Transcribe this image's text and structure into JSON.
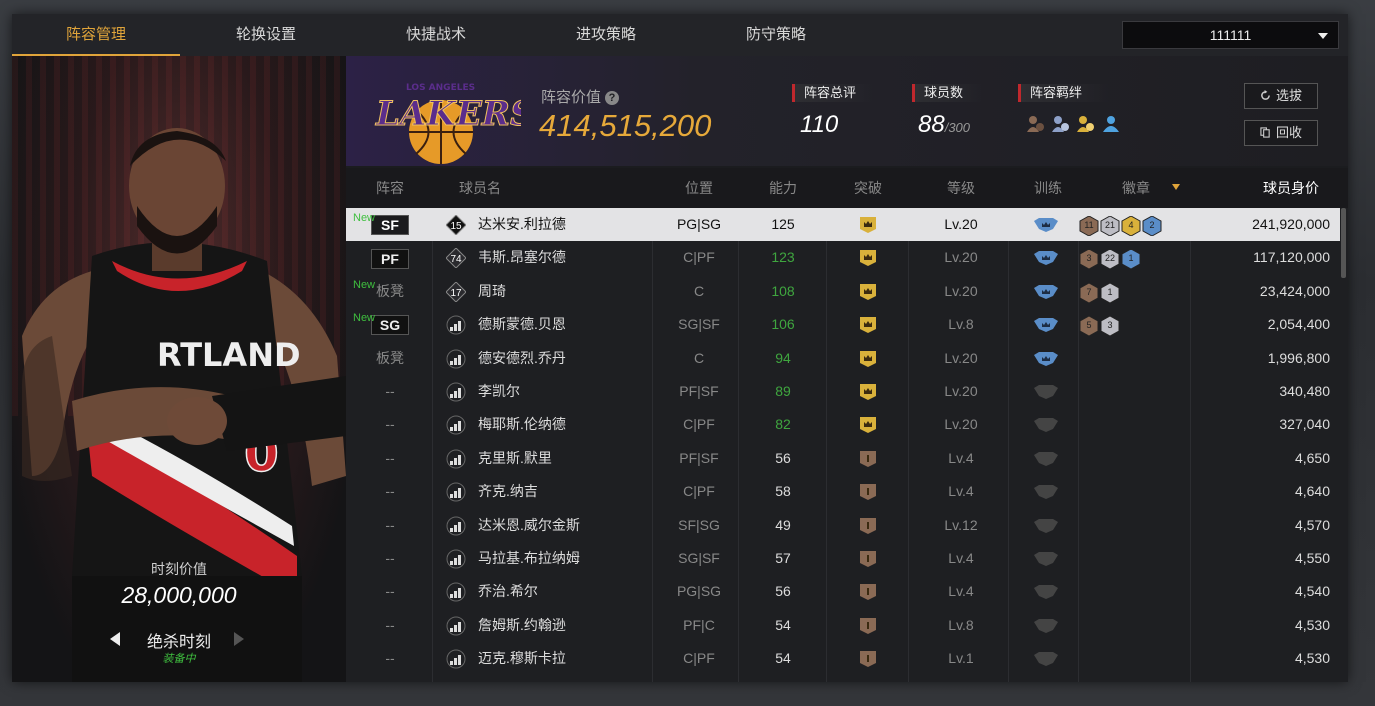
{
  "tabs": [
    {
      "label": "阵容管理",
      "active": true
    },
    {
      "label": "轮换设置",
      "active": false
    },
    {
      "label": "快捷战术",
      "active": false
    },
    {
      "label": "进攻策略",
      "active": false
    },
    {
      "label": "防守策略",
      "active": false
    }
  ],
  "team_select": {
    "value": "111111"
  },
  "left_panel": {
    "moment_label": "时刻价值",
    "moment_value": "28,000,000",
    "moment_name": "绝杀时刻",
    "moment_status": "装备中",
    "jersey_text": "RTLAND",
    "jersey_number": "0"
  },
  "header": {
    "logo_text": "LAKERS",
    "logo_subtext": "LOS ANGELES",
    "value_label": "阵容价值",
    "value": "414,515,200",
    "rating_label": "阵容总评",
    "rating_value": "110",
    "count_label": "球员数",
    "count_value": "88",
    "count_max": "/300",
    "bond_label": "阵容羁绊",
    "draft_button": "选拔",
    "recycle_button": "回收"
  },
  "columns": {
    "lineup": "阵容",
    "name": "球员名",
    "position": "位置",
    "ability": "能力",
    "breakthrough": "突破",
    "level": "等级",
    "training": "训练",
    "badges": "徽章",
    "price": "球员身价"
  },
  "players": [
    {
      "lineup": "SF",
      "lineup_type": "badge",
      "new": "New",
      "number": "15",
      "name": "达米安.利拉德",
      "position": "PG|SG",
      "ability": "125",
      "ability_color": "white",
      "crown": "gold",
      "level": "Lv.20",
      "training": "blue",
      "badges": [
        {
          "v": "11",
          "c": "bronze"
        },
        {
          "v": "21",
          "c": "silver"
        },
        {
          "v": "4",
          "c": "gold"
        },
        {
          "v": "2",
          "c": "blue"
        }
      ],
      "price": "241,920,000",
      "selected": true
    },
    {
      "lineup": "PF",
      "lineup_type": "badge",
      "new": "",
      "number": "74",
      "name": "韦斯.昂塞尔德",
      "position": "C|PF",
      "ability": "123",
      "ability_color": "green",
      "crown": "gold",
      "level": "Lv.20",
      "training": "blue",
      "badges": [
        {
          "v": "3",
          "c": "bronze"
        },
        {
          "v": "22",
          "c": "silver"
        },
        {
          "v": "1",
          "c": "blue"
        }
      ],
      "price": "117,120,000",
      "selected": false
    },
    {
      "lineup": "板凳",
      "lineup_type": "text",
      "new": "New",
      "number": "17",
      "name": "周琦",
      "position": "C",
      "ability": "108",
      "ability_color": "green",
      "crown": "gold",
      "level": "Lv.20",
      "training": "blue",
      "badges": [
        {
          "v": "7",
          "c": "bronze"
        },
        {
          "v": "1",
          "c": "silver"
        }
      ],
      "price": "23,424,000",
      "selected": false
    },
    {
      "lineup": "SG",
      "lineup_type": "badge",
      "new": "New",
      "number": "",
      "name": "德斯蒙德.贝恩",
      "position": "SG|SF",
      "ability": "106",
      "ability_color": "green",
      "crown": "gold",
      "level": "Lv.8",
      "training": "blue",
      "badges": [
        {
          "v": "5",
          "c": "bronze"
        },
        {
          "v": "3",
          "c": "silver"
        }
      ],
      "price": "2,054,400",
      "selected": false
    },
    {
      "lineup": "板凳",
      "lineup_type": "text",
      "new": "",
      "number": "",
      "name": "德安德烈.乔丹",
      "position": "C",
      "ability": "94",
      "ability_color": "green",
      "crown": "gold",
      "level": "Lv.20",
      "training": "blue",
      "badges": [],
      "price": "1,996,800",
      "selected": false
    },
    {
      "lineup": "--",
      "lineup_type": "text",
      "new": "",
      "number": "",
      "name": "李凯尔",
      "position": "PF|SF",
      "ability": "89",
      "ability_color": "green",
      "crown": "gold",
      "level": "Lv.20",
      "training": "gray",
      "badges": [],
      "price": "340,480",
      "selected": false
    },
    {
      "lineup": "--",
      "lineup_type": "text",
      "new": "",
      "number": "",
      "name": "梅耶斯.伦纳德",
      "position": "C|PF",
      "ability": "82",
      "ability_color": "green",
      "crown": "gold",
      "level": "Lv.20",
      "training": "gray",
      "badges": [],
      "price": "327,040",
      "selected": false
    },
    {
      "lineup": "--",
      "lineup_type": "text",
      "new": "",
      "number": "",
      "name": "克里斯.默里",
      "position": "PF|SF",
      "ability": "56",
      "ability_color": "white",
      "crown": "bronze",
      "level": "Lv.4",
      "training": "gray",
      "badges": [],
      "price": "4,650",
      "selected": false
    },
    {
      "lineup": "--",
      "lineup_type": "text",
      "new": "",
      "number": "",
      "name": "齐克.纳吉",
      "position": "C|PF",
      "ability": "58",
      "ability_color": "white",
      "crown": "bronze",
      "level": "Lv.4",
      "training": "gray",
      "badges": [],
      "price": "4,640",
      "selected": false
    },
    {
      "lineup": "--",
      "lineup_type": "text",
      "new": "",
      "number": "",
      "name": "达米恩.威尔金斯",
      "position": "SF|SG",
      "ability": "49",
      "ability_color": "white",
      "crown": "bronze",
      "level": "Lv.12",
      "training": "gray",
      "badges": [],
      "price": "4,570",
      "selected": false
    },
    {
      "lineup": "--",
      "lineup_type": "text",
      "new": "",
      "number": "",
      "name": "马拉基.布拉纳姆",
      "position": "SG|SF",
      "ability": "57",
      "ability_color": "white",
      "crown": "bronze",
      "level": "Lv.4",
      "training": "gray",
      "badges": [],
      "price": "4,550",
      "selected": false
    },
    {
      "lineup": "--",
      "lineup_type": "text",
      "new": "",
      "number": "",
      "name": "乔治.希尔",
      "position": "PG|SG",
      "ability": "56",
      "ability_color": "white",
      "crown": "bronze",
      "level": "Lv.4",
      "training": "gray",
      "badges": [],
      "price": "4,540",
      "selected": false
    },
    {
      "lineup": "--",
      "lineup_type": "text",
      "new": "",
      "number": "",
      "name": "詹姆斯.约翰逊",
      "position": "PF|C",
      "ability": "54",
      "ability_color": "white",
      "crown": "bronze",
      "level": "Lv.8",
      "training": "gray",
      "badges": [],
      "price": "4,530",
      "selected": false
    },
    {
      "lineup": "--",
      "lineup_type": "text",
      "new": "",
      "number": "",
      "name": "迈克.穆斯卡拉",
      "position": "C|PF",
      "ability": "54",
      "ability_color": "white",
      "crown": "bronze",
      "level": "Lv.1",
      "training": "gray",
      "badges": [],
      "price": "4,530",
      "selected": false
    }
  ],
  "colors": {
    "accent": "#e0a43a",
    "green": "#3fa63f",
    "red_marker": "#c0282d",
    "gold": "#d9b13b",
    "bronze": "#8a6a55",
    "silver": "#bdbdc4",
    "blue": "#5a8dc8"
  }
}
